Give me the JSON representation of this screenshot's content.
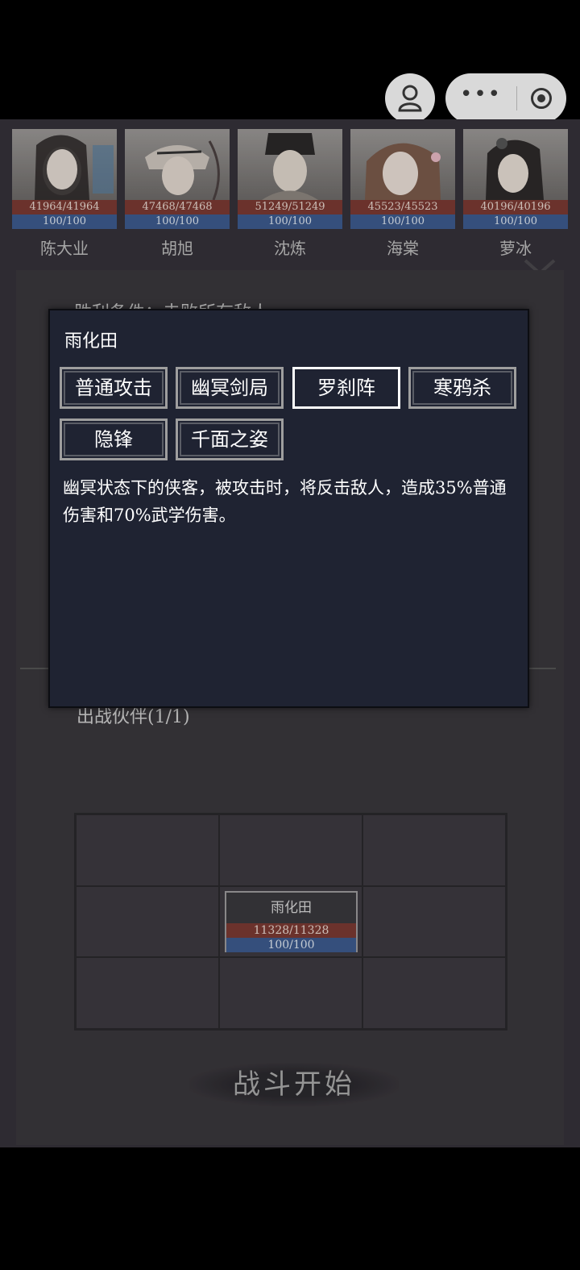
{
  "heroes": [
    {
      "name": "陈大业",
      "hp": "41964/41964",
      "mp": "100/100"
    },
    {
      "name": "胡旭",
      "hp": "47468/47468",
      "mp": "100/100"
    },
    {
      "name": "沈炼",
      "hp": "51249/51249",
      "mp": "100/100"
    },
    {
      "name": "海棠",
      "hp": "45523/45523",
      "mp": "100/100"
    },
    {
      "name": "萝冰",
      "hp": "40196/40196",
      "mp": "100/100"
    }
  ],
  "background": {
    "victory_condition": "胜利条件：击败所有敌人",
    "partners_label": "出战伙伴(1/1)"
  },
  "formation": {
    "unit": {
      "name": "雨化田",
      "hp": "11328/11328",
      "mp": "100/100"
    }
  },
  "start_button": "战斗开始",
  "dialog": {
    "title": "雨化田",
    "skills": [
      "普通攻击",
      "幽冥剑局",
      "罗刹阵",
      "寒鸦杀",
      "隐锋",
      "千面之姿"
    ],
    "selected_skill": "罗刹阵",
    "description": "幽冥状态下的侠客，被攻击时，将反击敌人，造成35%普通伤害和70%武学伤害。"
  },
  "colors": {
    "hp": "#7a3a33",
    "mp": "#3d5b8e",
    "dialog": "#1f2332",
    "background": "#353239"
  }
}
